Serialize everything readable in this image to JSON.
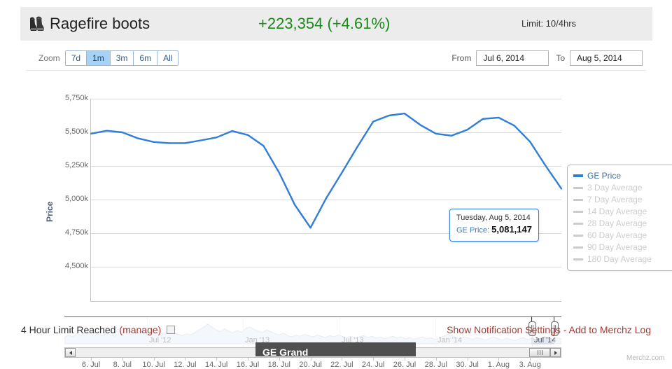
{
  "header": {
    "item_name": "Ragefire boots",
    "item_icon": "boots-icon",
    "price_change": "+223,354 (+4.61%)",
    "price_change_color": "#1a8a1a",
    "limit": "Limit: 10/4hrs"
  },
  "controls": {
    "zoom_label": "Zoom",
    "ranges": [
      {
        "label": "7d",
        "selected": false
      },
      {
        "label": "1m",
        "selected": true
      },
      {
        "label": "3m",
        "selected": false
      },
      {
        "label": "6m",
        "selected": false
      },
      {
        "label": "All",
        "selected": false
      }
    ],
    "from_label": "From",
    "from_value": "Jul 6, 2014",
    "to_label": "To",
    "to_value": "Aug 5, 2014"
  },
  "legend": {
    "items": [
      {
        "label": "GE Price",
        "active": true
      },
      {
        "label": "3 Day Average",
        "active": false
      },
      {
        "label": "7 Day Average",
        "active": false
      },
      {
        "label": "14 Day Average",
        "active": false
      },
      {
        "label": "28 Day Average",
        "active": false
      },
      {
        "label": "60 Day Average",
        "active": false
      },
      {
        "label": "90 Day Average",
        "active": false
      },
      {
        "label": "180 Day Average",
        "active": false
      }
    ]
  },
  "tooltip": {
    "date": "Tuesday, Aug 5, 2014",
    "series_label": "GE Price:",
    "value": "5,081,147"
  },
  "navigator": {
    "labels": [
      "Jul '12",
      "Jan '13",
      "Jul '13",
      "Jan '14",
      "Jul '14"
    ],
    "handle_left_pct": 94.0,
    "handle_right_pct": 98.5
  },
  "watermark": "Merchz.com",
  "footer": {
    "limit_text": "4 Hour Limit Reached",
    "manage_label": "(manage)",
    "notification_link": "Show Notification Settings",
    "separator": " - ",
    "merchz_link": "Add to Merchz Log"
  },
  "bottom_bar": {
    "text": "GE Grand"
  },
  "chart_data": {
    "type": "line",
    "title": "Ragefire boots",
    "xlabel": "",
    "ylabel": "Price",
    "ylim": [
      4500000,
      5830000
    ],
    "ytick_labels": [
      "5,750k",
      "5,500k",
      "5,250k",
      "5,000k",
      "4,750k",
      "4,500k"
    ],
    "ytick_values": [
      5750000,
      5500000,
      5250000,
      5000000,
      4750000,
      4500000
    ],
    "xtick_labels": [
      "6. Jul",
      "8. Jul",
      "10. Jul",
      "12. Jul",
      "14. Jul",
      "16. Jul",
      "18. Jul",
      "20. Jul",
      "22. Jul",
      "24. Jul",
      "26. Jul",
      "28. Jul",
      "30. Jul",
      "1. Aug",
      "3. Aug"
    ],
    "grid": true,
    "legend_position": "right",
    "series": [
      {
        "name": "GE Price",
        "color": "#2f7ed8",
        "x": [
          "6. Jul",
          "7. Jul",
          "8. Jul",
          "9. Jul",
          "10. Jul",
          "11. Jul",
          "12. Jul",
          "13. Jul",
          "14. Jul",
          "15. Jul",
          "16. Jul",
          "17. Jul",
          "18. Jul",
          "19. Jul",
          "20. Jul",
          "21. Jul",
          "22. Jul",
          "23. Jul",
          "24. Jul",
          "25. Jul",
          "26. Jul",
          "27. Jul",
          "28. Jul",
          "29. Jul",
          "30. Jul",
          "31. Jul",
          "1. Aug",
          "2. Aug",
          "3. Aug",
          "4. Aug",
          "5. Aug"
        ],
        "values": [
          5490000,
          5512000,
          5500000,
          5455000,
          5428000,
          5420000,
          5420000,
          5440000,
          5462000,
          5510000,
          5480000,
          5400000,
          5200000,
          4960000,
          4790000,
          5010000,
          5200000,
          5395000,
          5580000,
          5625000,
          5640000,
          5555000,
          5490000,
          5475000,
          5520000,
          5600000,
          5610000,
          5550000,
          5430000,
          5250000,
          5081147
        ]
      }
    ]
  }
}
